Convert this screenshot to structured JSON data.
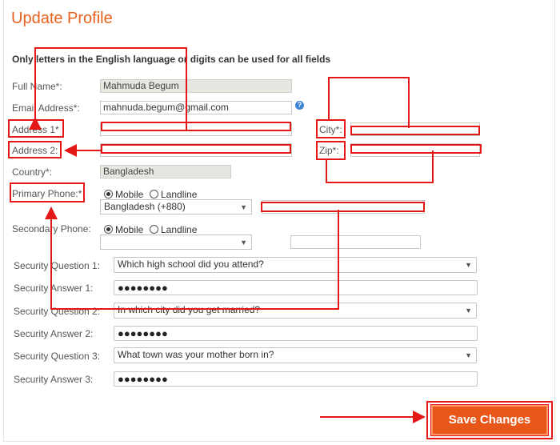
{
  "page": {
    "title": "Update Profile",
    "notice": "Only letters in the English language or digits can be used for all fields"
  },
  "form": {
    "full_name": {
      "label": "Full Name*:",
      "value": "Mahmuda Begum"
    },
    "email": {
      "label": "Email Address*:",
      "value": "mahnuda.begum@gmail.com"
    },
    "address1": {
      "label": "Address 1*",
      "value": ""
    },
    "city": {
      "label": "City*:",
      "value": ""
    },
    "address2": {
      "label": "Address 2:",
      "value": ""
    },
    "zip": {
      "label": "Zip*:",
      "value": ""
    },
    "country": {
      "label": "Country*:",
      "value": "Bangladesh"
    },
    "primary_phone": {
      "label": "Primary Phone:*",
      "radio_mobile": "Mobile",
      "radio_landline": "Landline",
      "selected": "Mobile",
      "country_code": "Bangladesh (+880)",
      "number": ""
    },
    "secondary_phone": {
      "label": "Secondary Phone:",
      "radio_mobile": "Mobile",
      "radio_landline": "Landline",
      "selected": "Mobile",
      "country_code": "",
      "number": ""
    },
    "security": [
      {
        "q_label": "Security Question 1:",
        "question": "Which high school did you attend?",
        "a_label": "Security Answer 1:",
        "answer": "●●●●●●●●"
      },
      {
        "q_label": "Security Question 2:",
        "question": "In which city did you get married?",
        "a_label": "Security Answer 2:",
        "answer": "●●●●●●●●"
      },
      {
        "q_label": "Security Question 3:",
        "question": "What town was your mother born in?",
        "a_label": "Security Answer 3:",
        "answer": "●●●●●●●●"
      }
    ],
    "save_label": "Save Changes"
  },
  "colors": {
    "accent": "#e8601c",
    "annotation": "#e41717",
    "help": "#3b84d6"
  }
}
